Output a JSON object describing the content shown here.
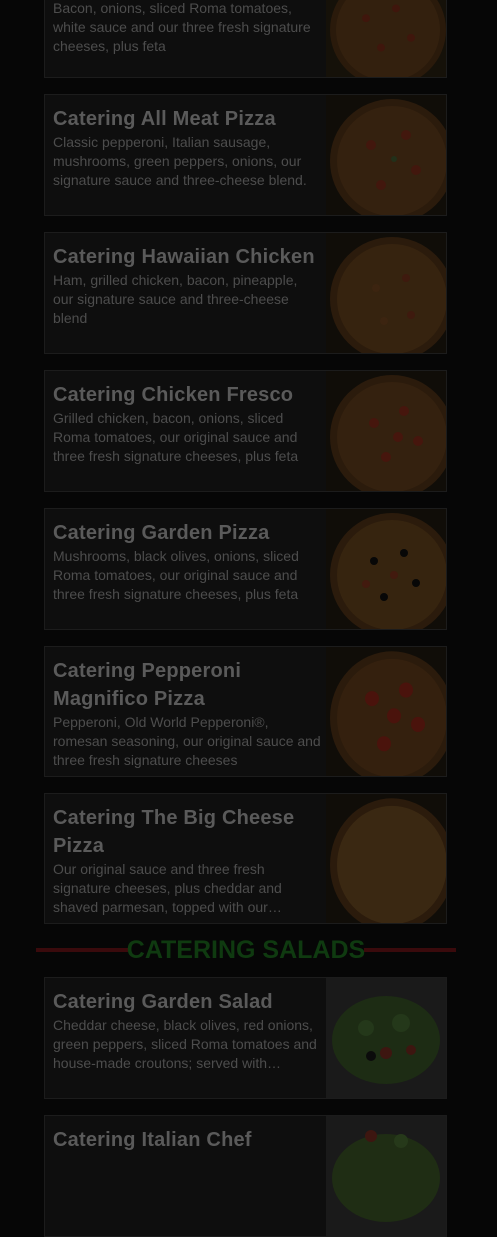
{
  "top_card": {
    "desc": "Bacon, onions, sliced Roma tomatoes, white sauce and our three fresh signature cheeses, plus feta",
    "image_icon": "pizza-image"
  },
  "pizzas": [
    {
      "title": "Catering All Meat Pizza",
      "desc": "Classic pepperoni, Italian sausage, mushrooms, green peppers, onions, our signature sauce and three-cheese blend."
    },
    {
      "title": "Catering Hawaiian Chicken",
      "desc": "Ham, grilled chicken, bacon, pineapple, our signature sauce and three-cheese blend"
    },
    {
      "title": "Catering Chicken Fresco",
      "desc": "Grilled chicken, bacon, onions, sliced Roma tomatoes, our original sauce and three fresh signature cheeses, plus feta"
    },
    {
      "title": "Catering Garden Pizza",
      "desc": "Mushrooms, black olives, onions, sliced Roma tomatoes, our original sauce and three fresh signature cheeses, plus feta"
    },
    {
      "title": "Catering Pepperoni Magnifico Pizza",
      "desc": "Pepperoni, Old World Pepperoni®, romesan seasoning, our original sauce and three fresh signature cheeses"
    },
    {
      "title": "Catering The Big Cheese Pizza",
      "desc": "Our original sauce and three fresh signature cheeses, plus cheddar and shaved parmesan, topped with our romesan seasoning"
    }
  ],
  "section": {
    "title": "CATERING SALADS"
  },
  "salads": [
    {
      "title": "Catering Garden Salad",
      "desc": "Cheddar cheese, black olives, red onions, green peppers, sliced Roma tomatoes and house-made croutons; served with dressing"
    },
    {
      "title": "Catering Italian Chef",
      "desc": ""
    }
  ],
  "colors": {
    "overlay": "#060606",
    "section_title": "#0f3a10",
    "section_rule": "#3a0a0c"
  }
}
